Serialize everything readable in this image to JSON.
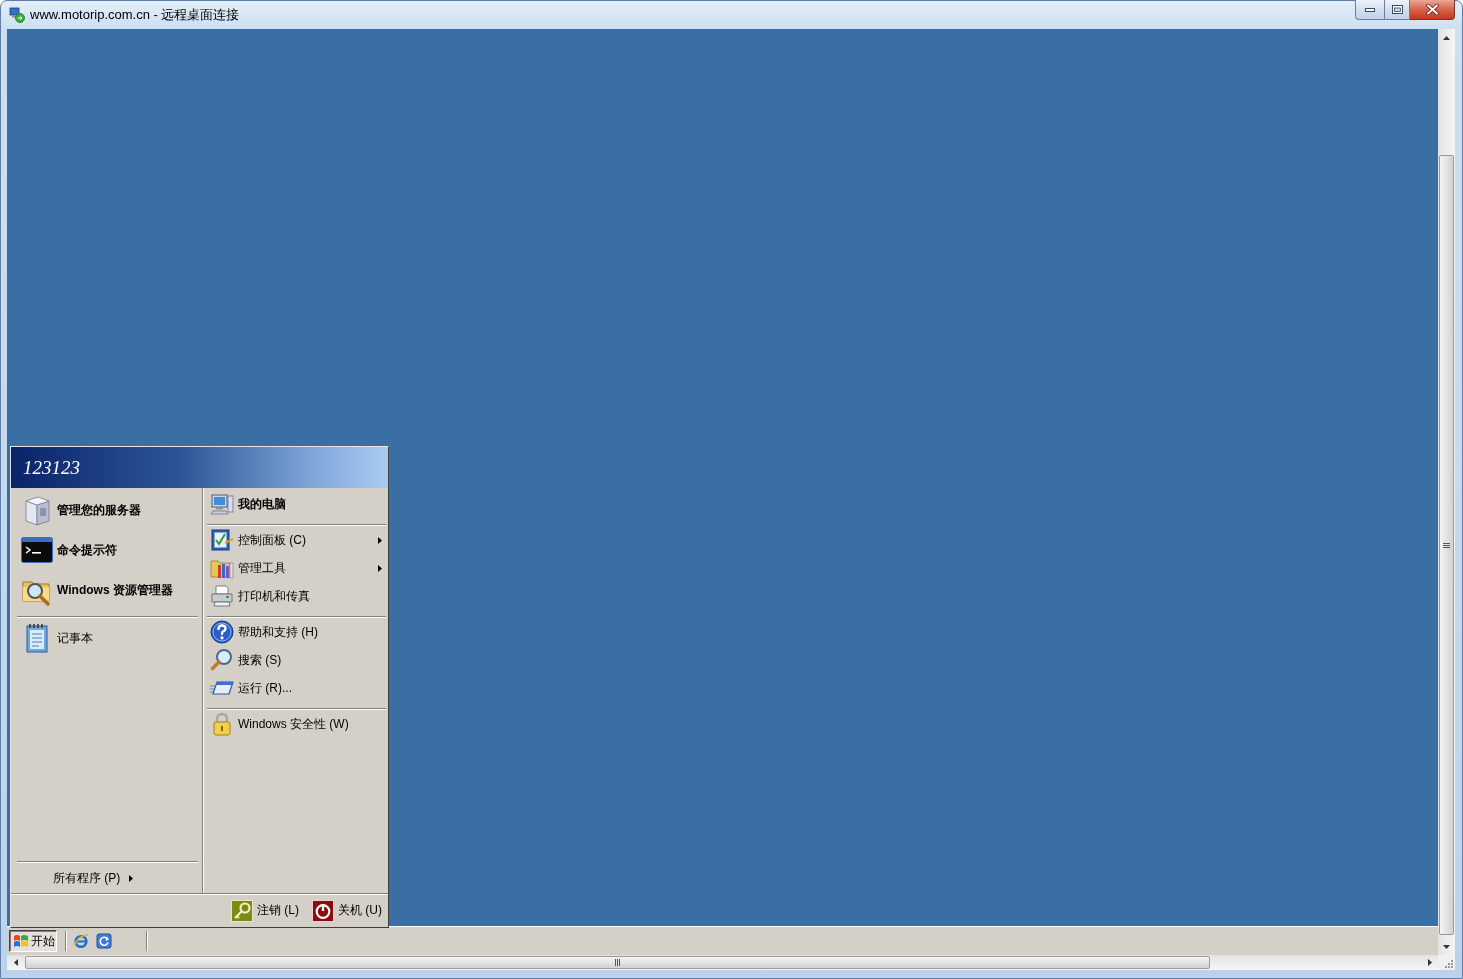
{
  "window": {
    "title": "www.motorip.com.cn - 远程桌面连接"
  },
  "start_menu": {
    "user_name": "123123",
    "pinned_programs": [
      {
        "label": "管理您的服务器"
      },
      {
        "label": "命令提示符"
      },
      {
        "label": "Windows 资源管理器"
      }
    ],
    "recent_programs": [
      {
        "label": "记事本"
      }
    ],
    "all_programs": {
      "label": "所有程序 (P)"
    },
    "places": [
      {
        "label": "我的电脑",
        "submenu": false
      }
    ],
    "sections": [
      {
        "items": [
          {
            "label": "控制面板 (C)",
            "submenu": true
          },
          {
            "label": "管理工具",
            "submenu": true
          },
          {
            "label": "打印机和传真",
            "submenu": false
          }
        ]
      },
      {
        "items": [
          {
            "label": "帮助和支持 (H)",
            "submenu": false
          },
          {
            "label": "搜索 (S)",
            "submenu": false
          },
          {
            "label": "运行 (R)...",
            "submenu": false
          }
        ]
      },
      {
        "items": [
          {
            "label": "Windows 安全性 (W)",
            "submenu": false
          }
        ]
      }
    ],
    "footer_buttons": [
      {
        "label": "注销 (L)"
      },
      {
        "label": "关机 (U)"
      }
    ]
  },
  "taskbar": {
    "start_button": "开始"
  }
}
